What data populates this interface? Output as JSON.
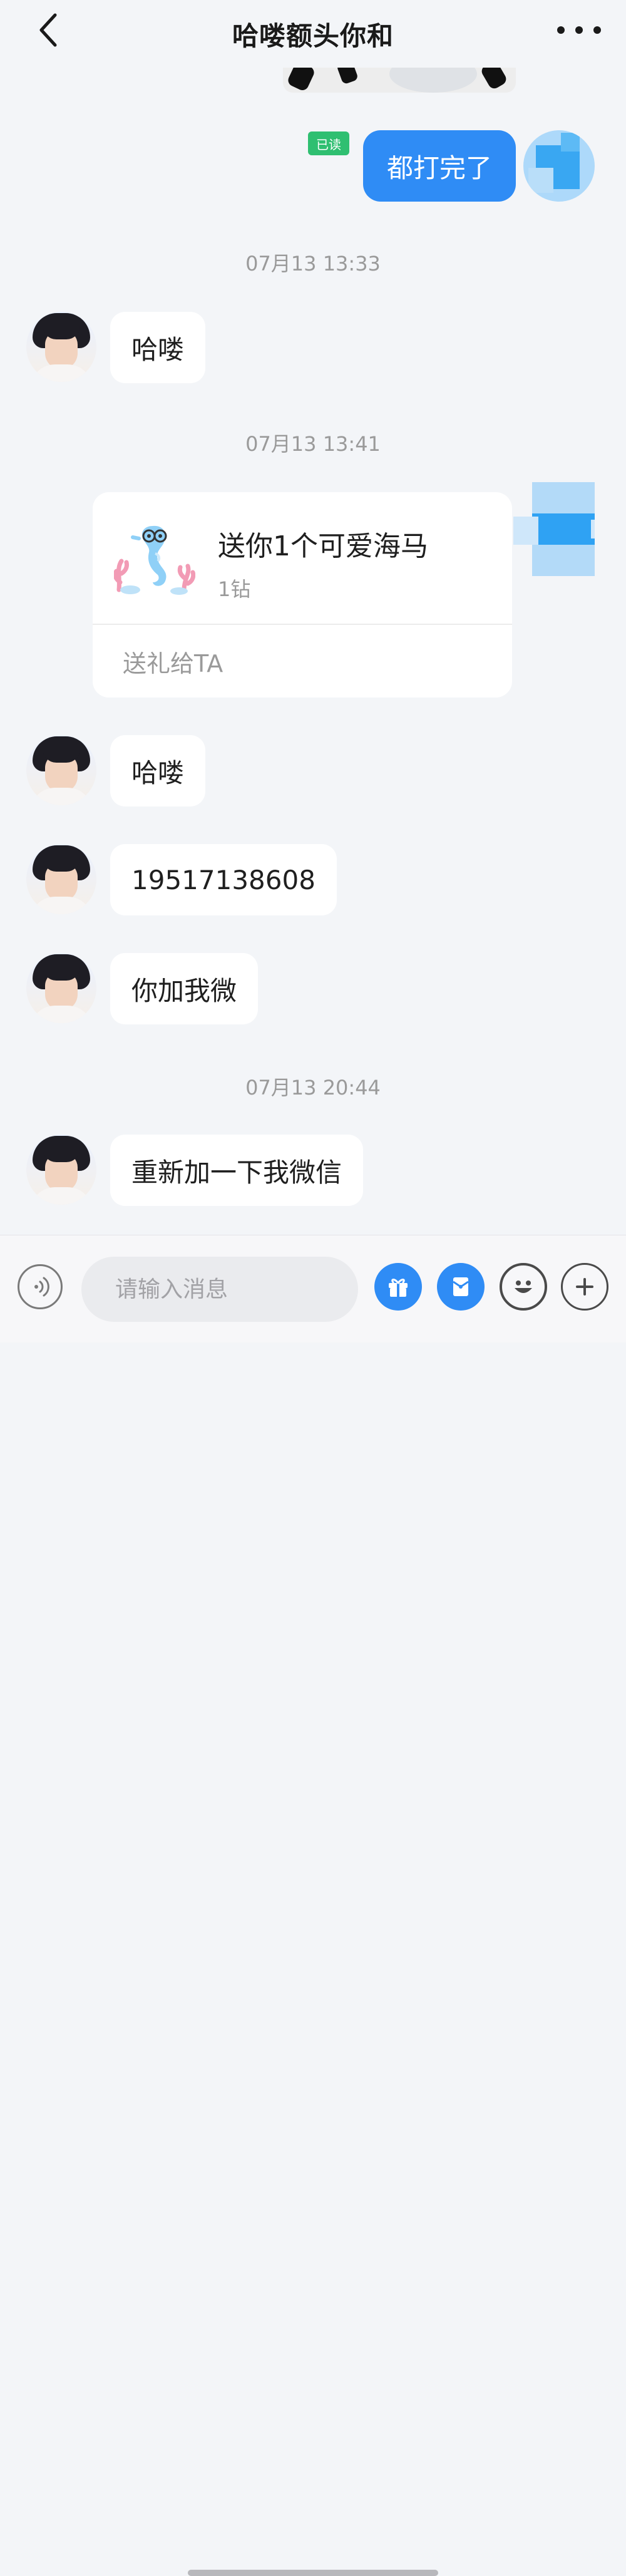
{
  "header": {
    "title": "哈喽额头你和"
  },
  "messages": {
    "read_badge": "已读",
    "out_1": "都打完了",
    "time_1": "07月13 13:33",
    "in_1": "哈喽",
    "time_2": "07月13 13:41",
    "gift": {
      "title": "送你1个可爱海马",
      "price": "1钻",
      "action": "送礼给TA"
    },
    "in_2": "哈喽",
    "in_3": "19517138608",
    "in_4": "你加我微",
    "time_3": "07月13 20:44",
    "in_5": "重新加一下我微信"
  },
  "input_bar": {
    "placeholder": "请输入消息"
  },
  "colors": {
    "accent": "#2f8cf5",
    "read_badge": "#2fbf71",
    "background": "#f3f5f8"
  },
  "icons": [
    "back-arrow-icon",
    "more-dots-icon",
    "voice-icon",
    "gift-icon",
    "red-packet-icon",
    "emoji-icon",
    "plus-icon"
  ]
}
